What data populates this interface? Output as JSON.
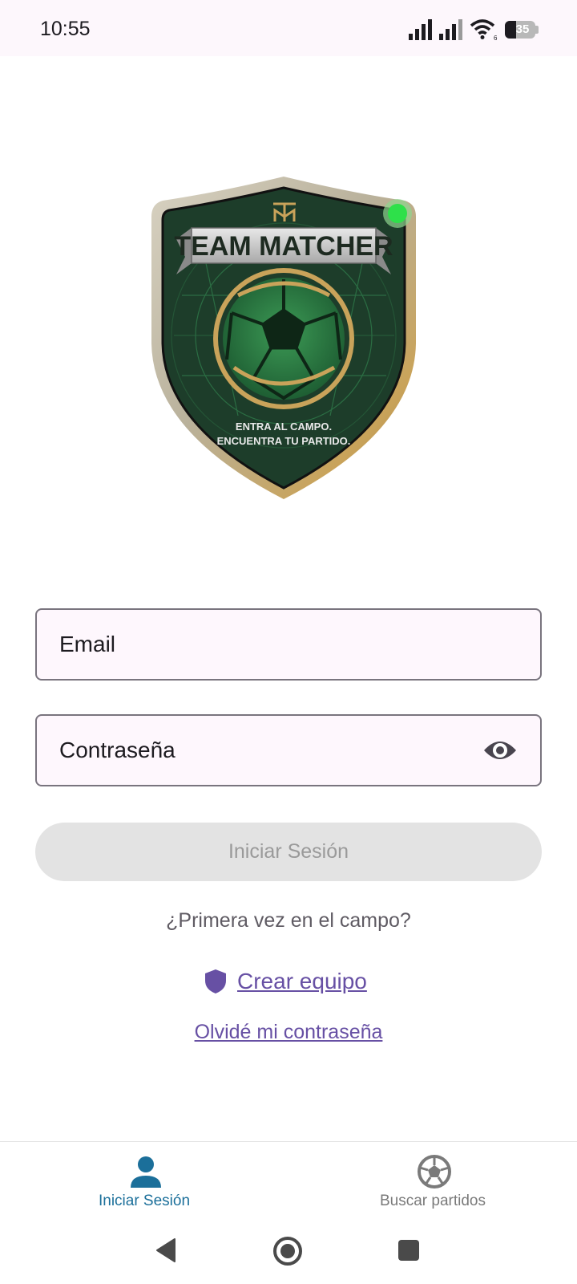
{
  "status_bar": {
    "time": "10:55",
    "battery": "35",
    "icons": [
      "signal-icon",
      "signal-icon",
      "wifi-icon",
      "battery-icon"
    ]
  },
  "logo": {
    "title": "TEAM MATCHER",
    "tagline_1": "ENTRA AL CAMPO.",
    "tagline_2": "ENCUENTRA TU PARTIDO."
  },
  "form": {
    "email_label": "Email",
    "password_label": "Contraseña",
    "login_button": "Iniciar Sesión",
    "first_time": "¿Primera vez en el campo?",
    "create_team": "Crear equipo",
    "forgot_password": "Olvidé mi contraseña"
  },
  "bottom_nav": {
    "items": [
      {
        "label": "Iniciar Sesión",
        "icon": "person-icon",
        "active": true
      },
      {
        "label": "Buscar partidos",
        "icon": "soccer-ball-icon",
        "active": false
      }
    ]
  },
  "colors": {
    "accent": "#6750a4",
    "nav_active": "#1b6f9a",
    "shield_green": "#1d3d2a",
    "gold": "#c9a35a"
  }
}
